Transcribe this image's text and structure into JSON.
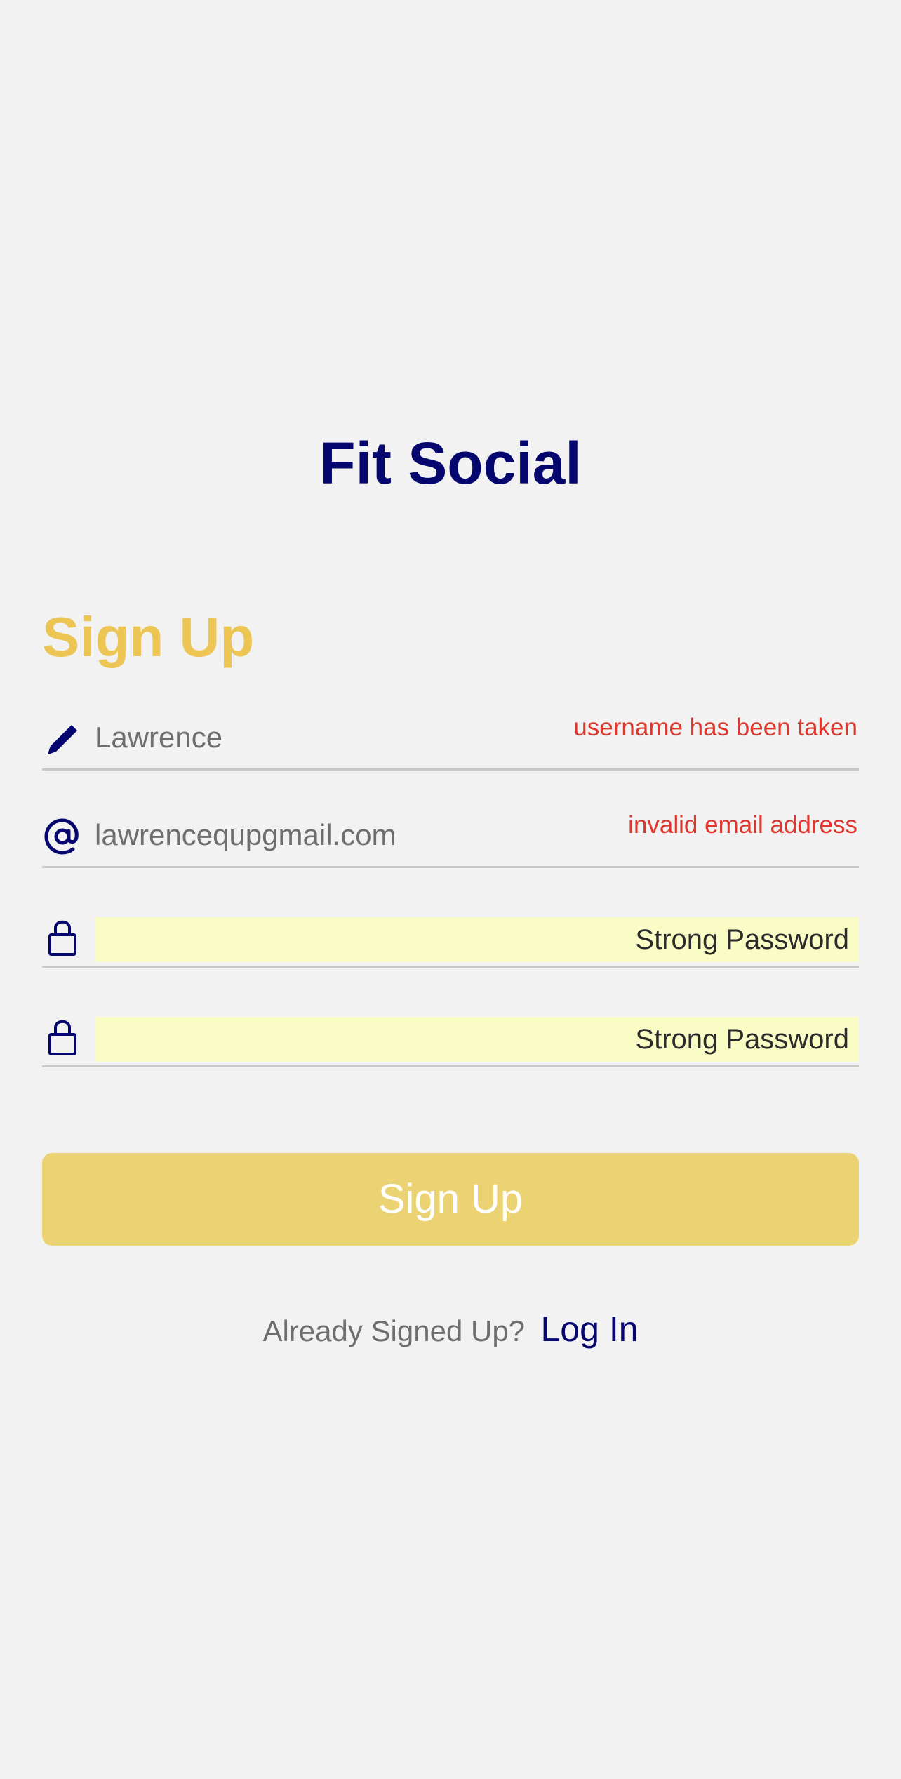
{
  "app": {
    "title": "Fit Social"
  },
  "form": {
    "heading": "Sign Up",
    "username": {
      "icon": "pencil-icon",
      "value": "Lawrence",
      "error": "username has been taken"
    },
    "email": {
      "icon": "at-sign-icon",
      "value": "lawrencequpgmail.com",
      "error": "invalid email address"
    },
    "password": {
      "icon": "lock-icon",
      "autofill_label": "Strong Password"
    },
    "confirm_password": {
      "icon": "lock-icon",
      "autofill_label": "Strong Password"
    },
    "submit_label": "Sign Up"
  },
  "footer": {
    "prompt": "Already Signed Up?",
    "link_label": "Log In"
  },
  "colors": {
    "background": "#f2f2f2",
    "brand_navy": "#06066f",
    "accent_yellow": "#ecc555",
    "button_yellow": "#ebd374",
    "error_red": "#e0352b",
    "autofill_highlight": "#fafcc6"
  }
}
